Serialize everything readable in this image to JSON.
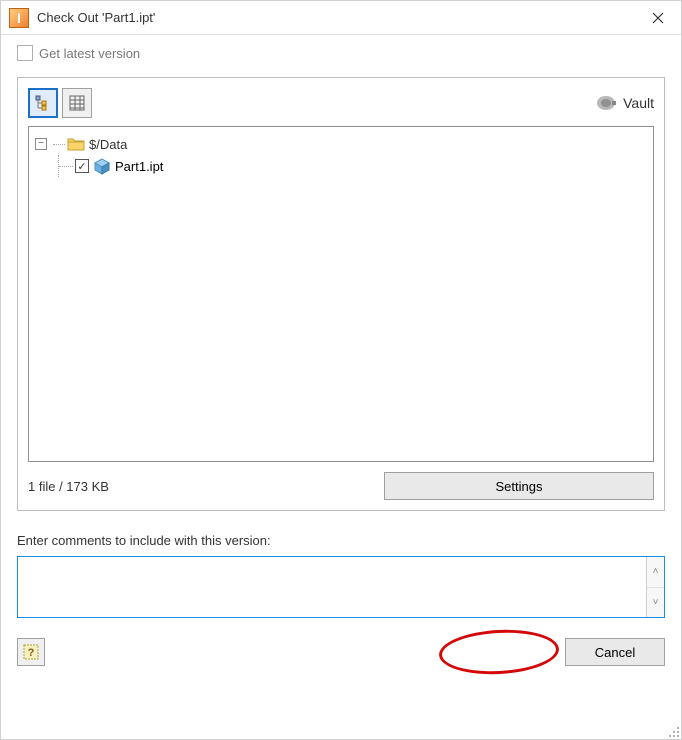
{
  "titlebar": {
    "title": "Check Out 'Part1.ipt'"
  },
  "checkbox_latest": {
    "label": "Get latest version"
  },
  "toolbar": {
    "vault_label": "Vault"
  },
  "tree": {
    "root": {
      "label": "$/Data"
    },
    "children": [
      {
        "label": "Part1.ipt"
      }
    ]
  },
  "status": {
    "text": "1 file / 173 KB"
  },
  "settings": {
    "label": "Settings"
  },
  "comments": {
    "label": "Enter comments to include with this version:",
    "value": ""
  },
  "footer": {
    "ok_label": "",
    "cancel_label": "Cancel"
  }
}
